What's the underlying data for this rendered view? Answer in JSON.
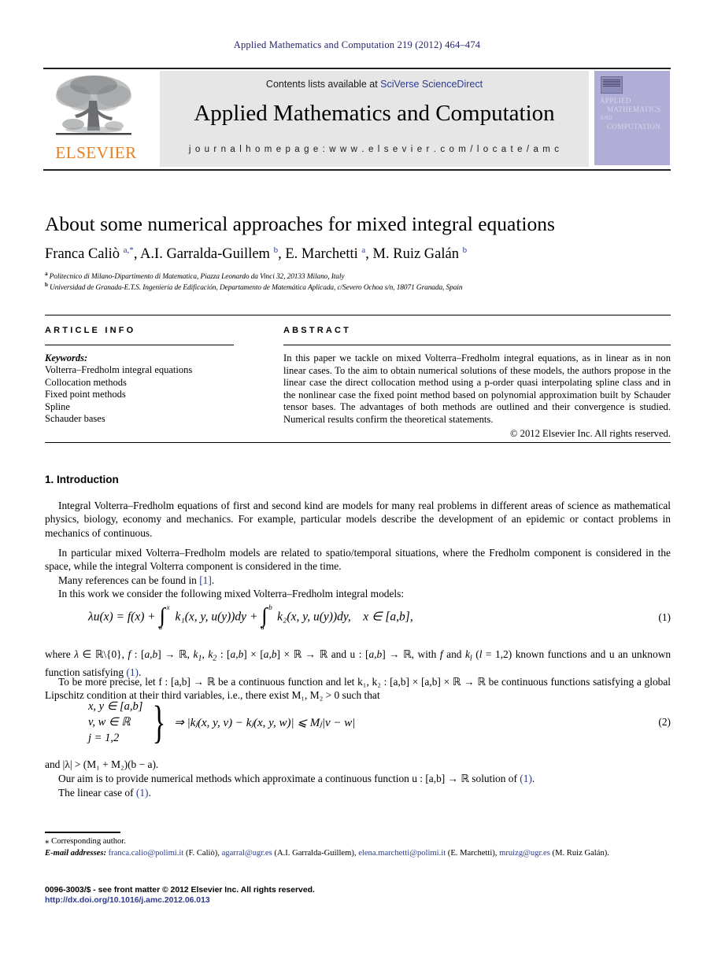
{
  "running_head": "Applied Mathematics and Computation 219 (2012) 464–474",
  "masthead": {
    "contents_prefix": "Contents lists available at ",
    "sciencedirect_link": "SciVerse ScienceDirect",
    "journal_name": "Applied Mathematics and Computation",
    "homepage": "j o u r n a l   h o m e p a g e :   w w w . e l s e v i e r . c o m / l o c a t e / a m c",
    "publisher": "ELSEVIER",
    "cover": {
      "line1": "APPLIED",
      "line2": "MATHEMATICS",
      "line3": "AND",
      "line4": "COMPUTATION"
    }
  },
  "article": {
    "title": "About some numerical approaches for mixed integral equations",
    "authors_html": "Franca Caliò <sup>a,*</sup>, A.I. Garralda-Guillem <sup>b</sup>, E. Marchetti <sup>a</sup>, M. Ruiz Galán <sup>b</sup>",
    "affiliation_a": "Politecnico di Milano-Dipartimento di Matematica, Piazza Leonardo da Vinci 32, 20133 Milano, Italy",
    "affiliation_b": "Universidad de Granada-E.T.S. Ingeniería de Edificación, Departamento de Matemática Aplicada, c/Severo Ochoa s/n, 18071 Granada, Spain"
  },
  "info": {
    "heading": "ARTICLE INFO",
    "keywords_label": "Keywords:",
    "keywords": [
      "Volterra–Fredholm integral equations",
      "Collocation methods",
      "Fixed point methods",
      "Spline",
      "Schauder bases"
    ]
  },
  "abstract": {
    "heading": "ABSTRACT",
    "text": "In this paper we tackle on mixed Volterra–Fredholm integral equations, as in linear as in non linear cases. To the aim to obtain numerical solutions of these models, the authors propose in the linear case the direct collocation method using a p-order quasi interpolating spline class and in the nonlinear case the fixed point method based on polynomial approximation built by Schauder tensor bases. The advantages of both methods are outlined and their convergence is studied. Numerical results confirm the theoretical statements.",
    "copyright": "© 2012 Elsevier Inc. All rights reserved."
  },
  "body": {
    "section_heading": "1. Introduction",
    "p1": "Integral Volterra–Fredholm equations of first and second kind are models for many real problems in different areas of science as mathematical physics, biology, economy and mechanics. For example, particular models describe the development of an epidemic or contact problems in mechanics of continuous.",
    "p2": "In particular mixed Volterra–Fredholm models are related to spatio/temporal situations, where the Fredholm component is considered in the space, while the integral Volterra component is considered in the time.",
    "p3_pre": "Many references can be found in ",
    "p3_ref": "[1]",
    "p3_post": ".",
    "p4": "In this work we consider the following mixed Volterra–Fredholm integral models:",
    "p5_pre": "where λ ∈ ℝ\\{0}, f : [a,b] → ℝ, k",
    "p5_mid": ", k",
    "p5_rest": " : [a,b] × [a,b] × ℝ → ℝ and u : [a,b] → ℝ, with f and k",
    "p5_tail": " (l = 1,2) known functions and u an unknown function satisfying ",
    "p5_ref": "(1)",
    "p5_end": ".",
    "p6": "To be more precise, let f : [a,b] → ℝ be a continuous function and let k₁,  k₂ : [a,b] × [a,b] × ℝ → ℝ be continuous functions satisfying a global Lipschitz condition at their third variables, i.e., there exist M₁,  M₂ > 0 such that",
    "p7": "and |λ| > (M₁ + M₂)(b − a).",
    "p8_pre": "Our aim is to provide numerical methods which approximate a continuous function u : [a,b] → ℝ solution of ",
    "p8_ref": "(1)",
    "p8_post": ".",
    "p9_pre": "The linear case of ",
    "p9_ref": "(1)",
    "p9_post": "."
  },
  "equations": {
    "eq1": {
      "number": "(1)",
      "lhs": "λu(x) = f(x) +",
      "int1_lower": "a",
      "int1_upper": "x",
      "int1_body": "k₁(x, y, u(y))dy +",
      "int2_lower": "a",
      "int2_upper": "b",
      "int2_body": "k₂(x, y, u(y))dy,",
      "domain": "x ∈ [a,b],"
    },
    "eq2": {
      "number": "(2)",
      "case1": "x, y ∈ [a,b]",
      "case2": "v, w ∈ ℝ",
      "case3": "j = 1,2",
      "rhs": "⇒ |kⱼ(x, y, v) − kⱼ(x, y, w)| ⩽ Mⱼ|v − w|"
    }
  },
  "footnotes": {
    "corresponding": "Corresponding author.",
    "email_label": "E-mail addresses:",
    "emails": [
      {
        "address": "franca.calio@polimi.it",
        "owner": " (F. Caliò), "
      },
      {
        "address": "agarral@ugr.es",
        "owner": " (A.I. Garralda-Guillem), "
      },
      {
        "address": "elena.marchetti@polimi.it",
        "owner": " (E. Marchetti), "
      },
      {
        "address": "mruizg@ugr.es",
        "owner": " (M. Ruiz Galán)."
      }
    ],
    "issn_line": "0096-3003/$ - see front matter © 2012 Elsevier Inc. All rights reserved.",
    "doi_line": "http://dx.doi.org/10.1016/j.amc.2012.06.013"
  }
}
